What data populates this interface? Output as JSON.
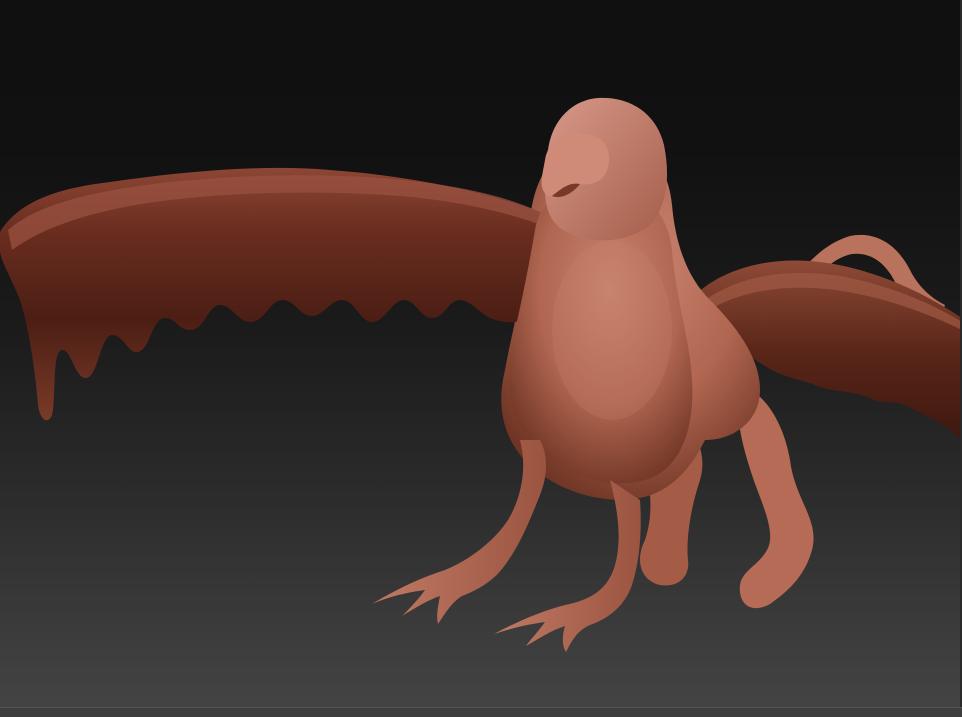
{
  "viewport": {
    "background_top": "#101010",
    "background_bottom": "#434343",
    "model_subject": "griffin-sculpt",
    "material_color": "#b06650",
    "material_shadow": "#4a2016"
  }
}
